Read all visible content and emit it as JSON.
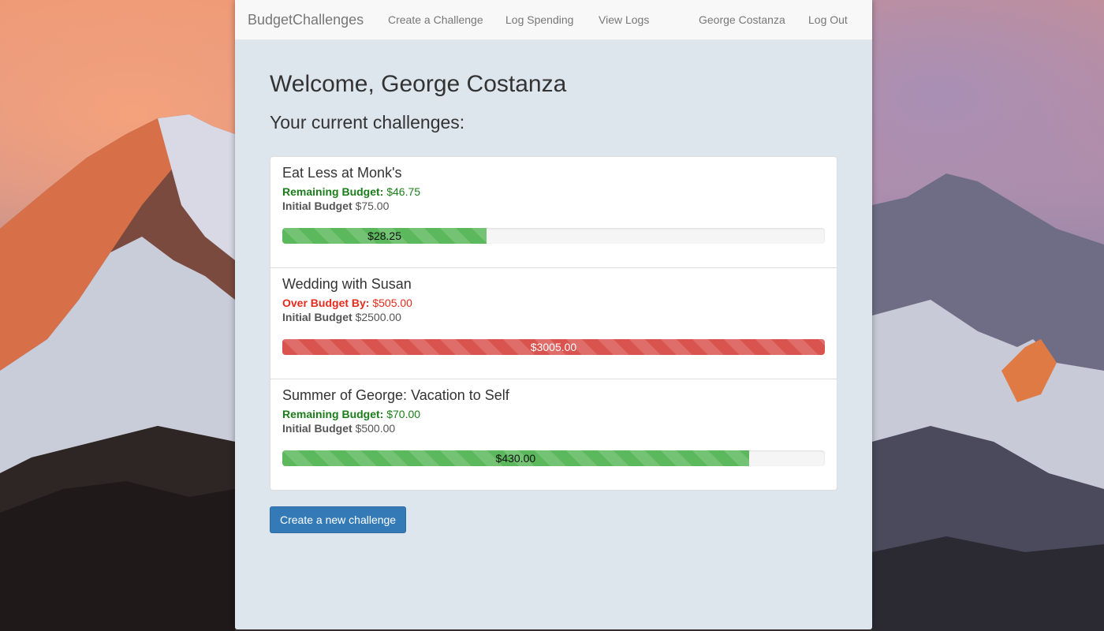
{
  "navbar": {
    "brand": "BudgetChallenges",
    "links": [
      "Create a Challenge",
      "Log Spending",
      "View Logs"
    ],
    "user": "George Costanza",
    "logout": "Log Out"
  },
  "page": {
    "welcome": "Welcome, George Costanza",
    "subtitle": "Your current challenges:",
    "create_button": "Create a new challenge"
  },
  "challenges": [
    {
      "title": "Eat Less at Monk's",
      "status_label": "Remaining Budget:",
      "status_value": "$46.75",
      "status": "good",
      "initial_label": "Initial Budget",
      "initial_value": "$75.00",
      "spent_label": "$28.25",
      "progress_fraction": 0.3767
    },
    {
      "title": "Wedding with Susan",
      "status_label": "Over Budget By:",
      "status_value": "$505.00",
      "status": "bad",
      "initial_label": "Initial Budget",
      "initial_value": "$2500.00",
      "spent_label": "$3005.00",
      "progress_fraction": 1.0
    },
    {
      "title": "Summer of George: Vacation to Self",
      "status_label": "Remaining Budget:",
      "status_value": "$70.00",
      "status": "good",
      "initial_label": "Initial Budget",
      "initial_value": "$500.00",
      "spent_label": "$430.00",
      "progress_fraction": 0.86
    }
  ],
  "colors": {
    "success": "#5cb85c",
    "danger": "#d9534f",
    "good_text": "#1a7d1a",
    "bad_text": "#e62b1e",
    "primary": "#337ab7"
  }
}
